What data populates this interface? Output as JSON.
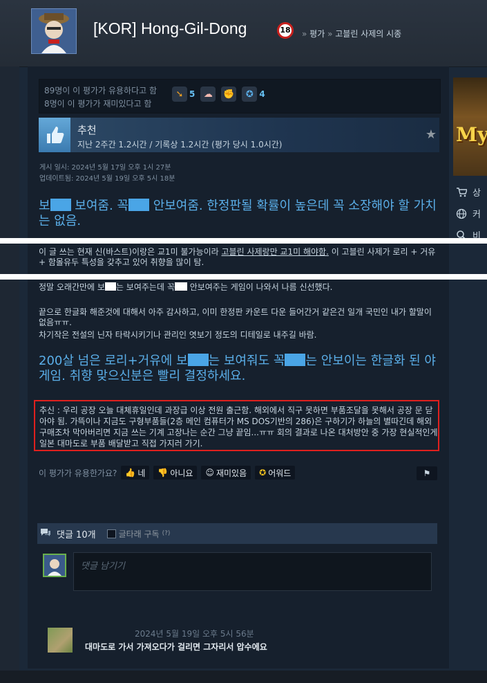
{
  "header": {
    "username": "[KOR] Hong-Gil-Dong",
    "age_badge": "18",
    "breadcrumb_sep1": "»",
    "breadcrumb_review": "평가",
    "breadcrumb_sep2": "»",
    "breadcrumb_game": "고블린 사제의 시종"
  },
  "votes": {
    "helpful_line": "89명이 이 평가가 유용하다고 함",
    "funny_line": "8명이 이 평가가 재미있다고 함",
    "awards": [
      {
        "icon": "pointing-hand-icon",
        "count": "5"
      },
      {
        "icon": "brain-icon",
        "count": ""
      },
      {
        "icon": "flexing-icon",
        "count": ""
      },
      {
        "icon": "medal-icon",
        "count": "4"
      }
    ]
  },
  "recommendation": {
    "label": "추천",
    "hours": "지난 2주간 1.2시간 / 기록상 1.2시간 (평가 당시 1.0시간)"
  },
  "dates": {
    "posted": "게시 일시: 2024년 5월 17일 오후 1시 27분",
    "updated": "업데이트됨: 2024년 5월 19일 오후 5시 18분"
  },
  "review": {
    "h1_a": "보",
    "h1_b": " 보여줌. 꼭",
    "h1_c": " 안보여줌. 한정판될 확률이 높은데 꼭 소장해야 할 가치는 없음.",
    "p1_a": "이 글 쓰는 현재 신(바스트)이랑은 교1미 불가능이라 ",
    "p1_u": "고블린 사제랑만 교1미 해야함.",
    "p1_b": " 이 고블린 사제가 로리 + 거유 + 함몰유두 특성을 갖추고 있어 취향을 많이 탐.",
    "p2_a": "정말 오래간만에 보",
    "p2_b": "는 보여주는데 꼭",
    "p2_c": " 안보여주는 게임이 나와서 나름 신선했다.",
    "p3": "끝으로 한글화 해준것에 대해서 아주 감사하고, 이미 한정판 카운트 다운 들어간거 같은건 일개 국민인 내가 할말이 없음ㅠㅠ.",
    "p4": "차기작은 전설의 닌자 타락시키기나 관리인 엿보기 정도의 디테일로 내주길 바람.",
    "h2_a": "200살 넘은 로리+거유에 보",
    "h2_b": "는 보여줘도 꼭",
    "h2_c": "는 안보이는 한글화 된 야게임. 취향 맞으신분은 빨리 결정하세요.",
    "postscript": "추신 : 우리 공장 오늘 대체휴일인데 과장급 이상 전원 출근함. 해외에서 직구 못하면 부품조달을 못해서 공장 문 닫아야 됨. 가뜩이나 지금도 구형부품들(2층 메인 컴퓨터가 MS DOS기반의 286)은 구하기가 하늘의 별따긴데 해외구매조차 막아버리면 지금 쓰는 기계 고장나는 순간 그냥 끝임...ㅠㅠ 회의 결과로 나온 대처방안 중 가장 현실적인게 일본 대마도로 부품 배달받고 직접 가지러 가기."
  },
  "helpful": {
    "question": "이 평가가 유용한가요?",
    "yes": "네",
    "no": "아니요",
    "funny": "재미있음",
    "award": "어워드"
  },
  "comments": {
    "count_label": "댓글 10개",
    "subscribe_label": "글타래 구독",
    "help_mark": "(?)",
    "input_placeholder": "댓글 남기기",
    "first": {
      "date": "2024년 5월 19일 오후 5시 56분",
      "text": "대마도로 가서 가져오다가 걸리면 그자리서 압수에요"
    }
  },
  "sidebar_right": {
    "banner_text": "My",
    "links": [
      "상",
      "커",
      "비"
    ]
  },
  "colors": {
    "background": "#1b2838",
    "accent_blue": "#5aaee8",
    "highlight_red": "#e0201e"
  }
}
